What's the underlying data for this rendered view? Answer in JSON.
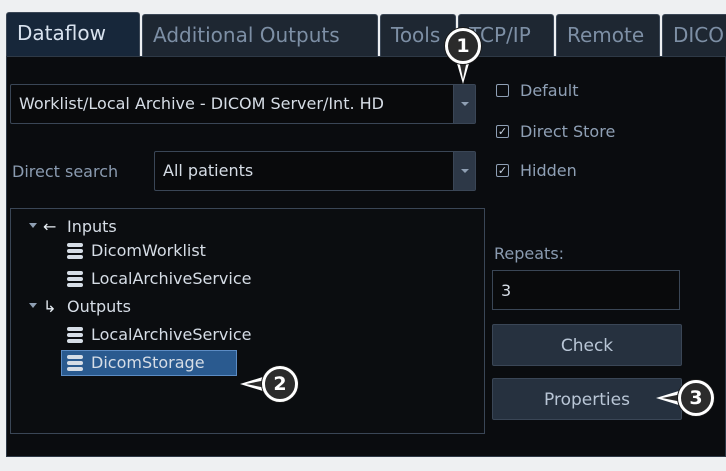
{
  "tabs": [
    {
      "label": "Dataflow",
      "active": true
    },
    {
      "label": "Additional Outputs"
    },
    {
      "label": "Tools"
    },
    {
      "label": "TCP/IP"
    },
    {
      "label": "Remote"
    },
    {
      "label": "DICO"
    }
  ],
  "dataflow_select": {
    "value": "Worklist/Local Archive - DICOM Server/Int. HD"
  },
  "direct_search": {
    "label": "Direct search",
    "value": "All patients"
  },
  "options": {
    "default": {
      "label": "Default",
      "checked": false
    },
    "direct_store": {
      "label": "Direct Store",
      "checked": true
    },
    "hidden": {
      "label": "Hidden",
      "checked": true
    }
  },
  "tree": {
    "inputs_label": "Inputs",
    "inputs": [
      "DicomWorklist",
      "LocalArchiveService"
    ],
    "outputs_label": "Outputs",
    "outputs": [
      "LocalArchiveService",
      "DicomStorage"
    ]
  },
  "repeats": {
    "label": "Repeats:",
    "value": "3"
  },
  "buttons": {
    "check": "Check",
    "properties": "Properties"
  },
  "callouts": [
    "1",
    "2",
    "3"
  ],
  "icons": {
    "checkmark": "✓",
    "inputs": "←",
    "outputs": "↳"
  },
  "colors": {
    "selection": "#2a5a8f",
    "panel": "#0a0c0f",
    "tab_active": "#17273a"
  }
}
